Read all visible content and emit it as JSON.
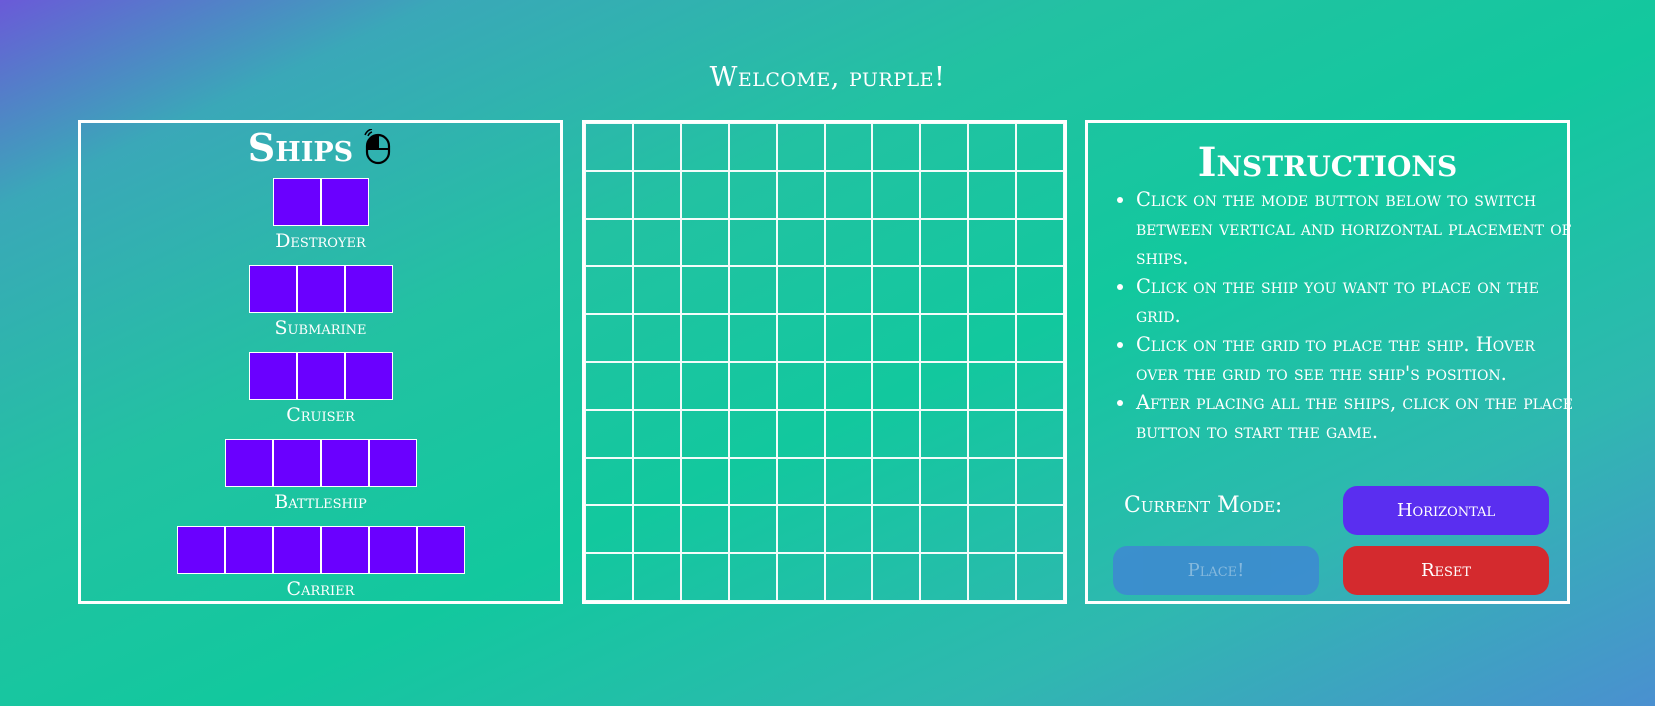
{
  "welcome": "Welcome, purple!",
  "ships_panel": {
    "title": "Ships",
    "icon": "mouse-icon",
    "ships": [
      {
        "name": "Destroyer",
        "size": 2
      },
      {
        "name": "Submarine",
        "size": 3
      },
      {
        "name": "Cruiser",
        "size": 3
      },
      {
        "name": "Battleship",
        "size": 4
      },
      {
        "name": "Carrier",
        "size": 6
      }
    ]
  },
  "board": {
    "rows": 10,
    "cols": 10
  },
  "instructions": {
    "title": "Instructions",
    "items": [
      "Click on the mode button below to switch between vertical and horizontal placement of ships.",
      "Click on the ship you want to place on the grid.",
      "Click on the grid to place the ship. Hover over the grid to see the ship's position.",
      "After placing all the ships, click on the place button to start the game."
    ],
    "mode_label": "Current Mode:",
    "mode_button": "Horizontal",
    "place_button": "Place!",
    "reset_button": "Reset"
  },
  "colors": {
    "ship": "#6a00ff",
    "mode_button": "#5a2ef0",
    "place_button": "#3d8bd0",
    "reset_button": "#d42a2e"
  }
}
